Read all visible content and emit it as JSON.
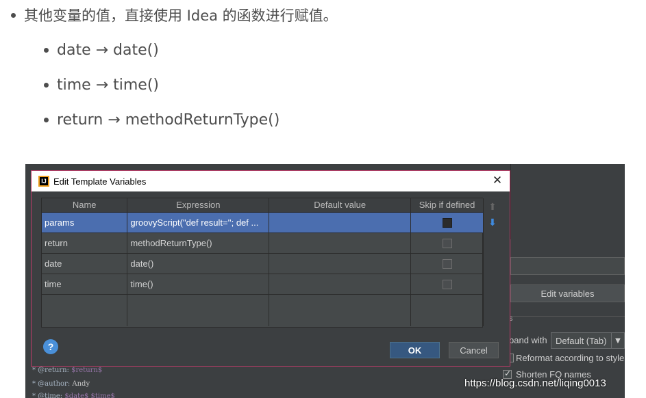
{
  "article": {
    "intro": "其他变量的值，直接使用 Idea 的函数进行赋值。",
    "items": [
      "date → date()",
      "time → time()",
      "return → methodReturnType()"
    ]
  },
  "ide": {
    "edit_variables_label": "Edit variables",
    "section_fragment": "s",
    "expand_label": "band with",
    "expand_value": "Default (Tab)",
    "reformat_label": "Reformat according to style",
    "reformat_checked": false,
    "shorten_label": "Shorten FQ names",
    "shorten_checked": true,
    "code_lines": [
      [
        "* @return: ",
        "$return$"
      ],
      [
        "* @author: ",
        "Andy"
      ],
      [
        "* @time: ",
        "$date$ $time$"
      ]
    ]
  },
  "dialog": {
    "title": "Edit Template Variables",
    "columns": [
      "Name",
      "Expression",
      "Default value",
      "Skip if defined"
    ],
    "rows": [
      {
        "name": "params",
        "expression": "groovyScript(\"def result=''; def ...",
        "default_value": "",
        "skip_if_defined": true,
        "selected": true
      },
      {
        "name": "return",
        "expression": "methodReturnType()",
        "default_value": "",
        "skip_if_defined": false,
        "selected": false
      },
      {
        "name": "date",
        "expression": "date()",
        "default_value": "",
        "skip_if_defined": false,
        "selected": false
      },
      {
        "name": "time",
        "expression": "time()",
        "default_value": "",
        "skip_if_defined": false,
        "selected": false
      }
    ],
    "help_label": "?",
    "ok_label": "OK",
    "cancel_label": "Cancel"
  },
  "watermark": "https://blog.csdn.net/liqing0013",
  "colors": {
    "selection": "#4b6eaf",
    "ok_button": "#365880",
    "dialog_border": "#c03c6a",
    "ide_background": "#3c3f41"
  }
}
